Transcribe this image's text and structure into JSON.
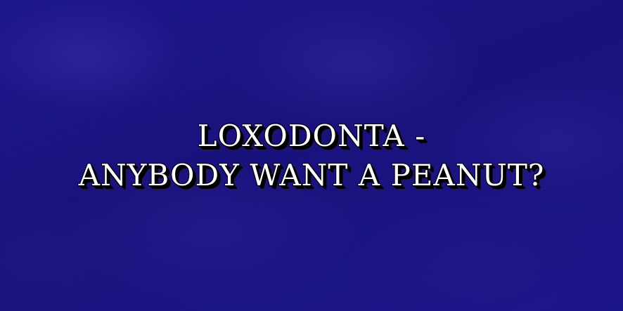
{
  "clue": {
    "lines": [
      "LOXODONTA -",
      "ANYBODY WANT A PEANUT?"
    ]
  },
  "colors": {
    "background": "#1c1485",
    "text": "#ffffff",
    "shadow": "#000000"
  }
}
